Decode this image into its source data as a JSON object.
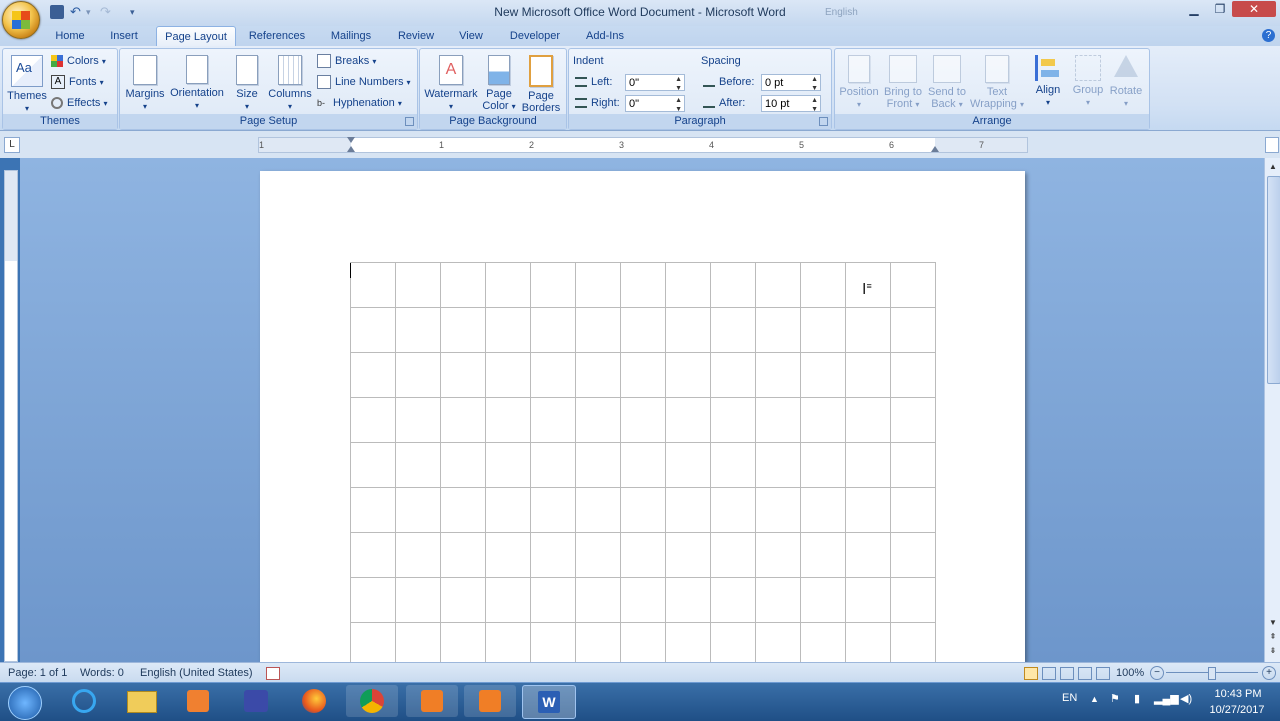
{
  "window": {
    "title": "New Microsoft Office Word Document - Microsoft Word",
    "ghost_title": "English"
  },
  "tabs": [
    {
      "label": "Home"
    },
    {
      "label": "Insert"
    },
    {
      "label": "Page Layout",
      "active": true
    },
    {
      "label": "References"
    },
    {
      "label": "Mailings"
    },
    {
      "label": "Review"
    },
    {
      "label": "View"
    },
    {
      "label": "Developer"
    },
    {
      "label": "Add-Ins"
    }
  ],
  "ribbon": {
    "themes": {
      "group_label": "Themes",
      "themes_label": "Themes",
      "colors_label": "Colors",
      "fonts_label": "Fonts",
      "effects_label": "Effects"
    },
    "page_setup": {
      "group_label": "Page Setup",
      "margins_label": "Margins",
      "orientation_label": "Orientation",
      "size_label": "Size",
      "columns_label": "Columns",
      "breaks_label": "Breaks",
      "line_numbers_label": "Line Numbers",
      "hyphenation_label": "Hyphenation"
    },
    "page_background": {
      "group_label": "Page Background",
      "watermark_label": "Watermark",
      "page_color_line1": "Page",
      "page_color_line2": "Color",
      "page_borders_line1": "Page",
      "page_borders_line2": "Borders"
    },
    "paragraph": {
      "group_label": "Paragraph",
      "indent_label": "Indent",
      "left_label": "Left:",
      "left_value": "0\"",
      "right_label": "Right:",
      "right_value": "0\"",
      "spacing_label": "Spacing",
      "before_label": "Before:",
      "before_value": "0 pt",
      "after_label": "After:",
      "after_value": "10 pt"
    },
    "arrange": {
      "group_label": "Arrange",
      "position_label": "Position",
      "bring_line1": "Bring to",
      "bring_line2": "Front",
      "send_line1": "Send to",
      "send_line2": "Back",
      "wrap_line1": "Text",
      "wrap_line2": "Wrapping",
      "align_label": "Align",
      "group_btn_label": "Group",
      "rotate_label": "Rotate"
    }
  },
  "ruler": {
    "numbers": [
      "1",
      "1",
      "2",
      "3",
      "4",
      "5",
      "6",
      "7"
    ]
  },
  "document": {
    "table": {
      "rows": 9,
      "cols": 13
    }
  },
  "status": {
    "page": "Page: 1 of 1",
    "words": "Words: 0",
    "language": "English (United States)",
    "zoom": "100%"
  },
  "taskbar": {
    "lang": "EN",
    "time": "10:43 PM",
    "date": "10/27/2017"
  },
  "colors": {
    "ribbon_text": "#15428b",
    "taskbar": "#1f4f86"
  }
}
